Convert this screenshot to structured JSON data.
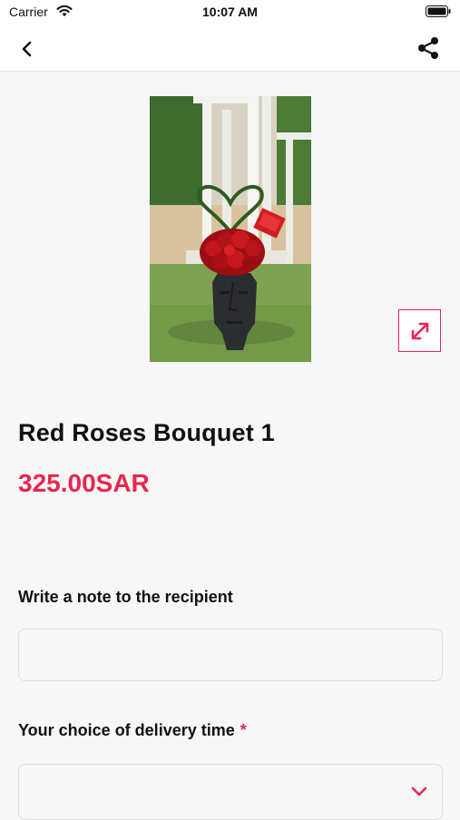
{
  "status_bar": {
    "carrier": "Carrier",
    "time": "10:07 AM"
  },
  "nav": {
    "back_icon": "chevron-left-icon",
    "share_icon": "share-icon"
  },
  "product": {
    "image_alt": "Red roses bouquet in black face vase",
    "expand_icon": "expand-icon",
    "title": "Red Roses Bouquet 1",
    "price": "325.00SAR"
  },
  "form": {
    "note_label": "Write a note to the recipient",
    "note_value": "",
    "note_placeholder": "",
    "delivery_label": "Your choice of delivery time",
    "delivery_required_mark": "*",
    "delivery_value": ""
  },
  "colors": {
    "accent": "#e8264f",
    "background": "#f7f7f7",
    "nav_background": "#ffffff"
  }
}
